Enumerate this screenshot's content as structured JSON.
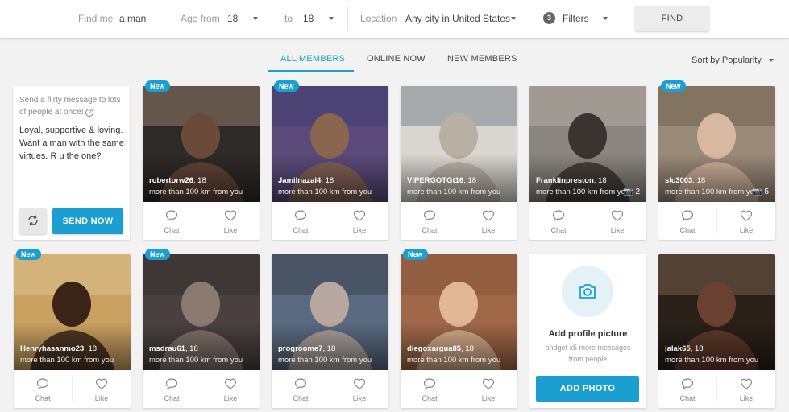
{
  "filters": {
    "find_me_label": "Find me",
    "find_me_value": "a man",
    "age_from_label": "Age from",
    "age_from_value": "18",
    "age_to_label": "to",
    "age_to_value": "18",
    "location_label": "Location",
    "location_value": "Any city in United States",
    "filters_count": "3",
    "filters_label": "Filters",
    "find_button": "FIND"
  },
  "tabs": [
    {
      "label": "ALL MEMBERS",
      "active": true
    },
    {
      "label": "ONLINE NOW",
      "active": false
    },
    {
      "label": "NEW MEMBERS",
      "active": false
    }
  ],
  "sort_label": "Sort by Popularity",
  "flirty": {
    "hint": "Send a flirty message to lots of people at once!",
    "message": "Loyal, supportive & loving. Want a man with the same virtues. R u the one?",
    "send_button": "SEND NOW"
  },
  "actions": {
    "chat": "Chat",
    "like": "Like"
  },
  "new_badge": "New",
  "members": [
    {
      "name": "robertorw26",
      "age": ", 18",
      "distance": "more than 100 km from you",
      "is_new": true,
      "photos": "",
      "tones": [
        "#2e2a28",
        "#6b4a3a",
        "#c9a98a"
      ]
    },
    {
      "name": "Jamilnazal4",
      "age": ", 18",
      "distance": "more than 100 km from you",
      "is_new": true,
      "photos": "",
      "tones": [
        "#5b4a7a",
        "#8a6650",
        "#2f3a6a"
      ]
    },
    {
      "name": "VIPERGOTGt16",
      "age": ", 18",
      "distance": "more than 100 km from you",
      "is_new": false,
      "photos": "",
      "tones": [
        "#d9d6cf",
        "#b8b0a3",
        "#4a5a6a"
      ]
    },
    {
      "name": "Franklinpreston",
      "age": ", 18",
      "distance": "more than 100 km from you",
      "is_new": false,
      "photos": "2",
      "tones": [
        "#8a8580",
        "#3a3330",
        "#c8c2b8"
      ]
    },
    {
      "name": "slc3003",
      "age": ", 18",
      "distance": "more than 100 km from you",
      "is_new": true,
      "photos": "5",
      "tones": [
        "#9a8a78",
        "#d8b8a0",
        "#5a4a3a"
      ]
    },
    {
      "name": "Henryhasanmo23",
      "age": ", 18",
      "distance": "more than 100 km from you",
      "is_new": true,
      "photos": "",
      "tones": [
        "#c9a060",
        "#3a2418",
        "#e8d8b0"
      ]
    },
    {
      "name": "msdrau61",
      "age": ", 18",
      "distance": "more than 100 km from you",
      "is_new": true,
      "photos": "",
      "tones": [
        "#4a4040",
        "#8a7a70",
        "#2a2424"
      ]
    },
    {
      "name": "progroome7",
      "age": ", 18",
      "distance": "more than 100 km from you",
      "is_new": false,
      "photos": "",
      "tones": [
        "#5a6a80",
        "#b8a8a0",
        "#2a2a30"
      ]
    },
    {
      "name": "diegoxargua85",
      "age": ", 18",
      "distance": "more than 100 km from you",
      "is_new": true,
      "photos": "",
      "tones": [
        "#a06848",
        "#e0b898",
        "#7a4a38"
      ]
    },
    {
      "name": "jalak65",
      "age": ", 18",
      "distance": "more than 100 km from you",
      "is_new": false,
      "photos": "",
      "tones": [
        "#2a2018",
        "#6a4030",
        "#a08068"
      ]
    }
  ],
  "add_photo": {
    "title": "Add profile picture",
    "subtitle": "andget x5 more messages from people",
    "button": "ADD PHOTO"
  }
}
